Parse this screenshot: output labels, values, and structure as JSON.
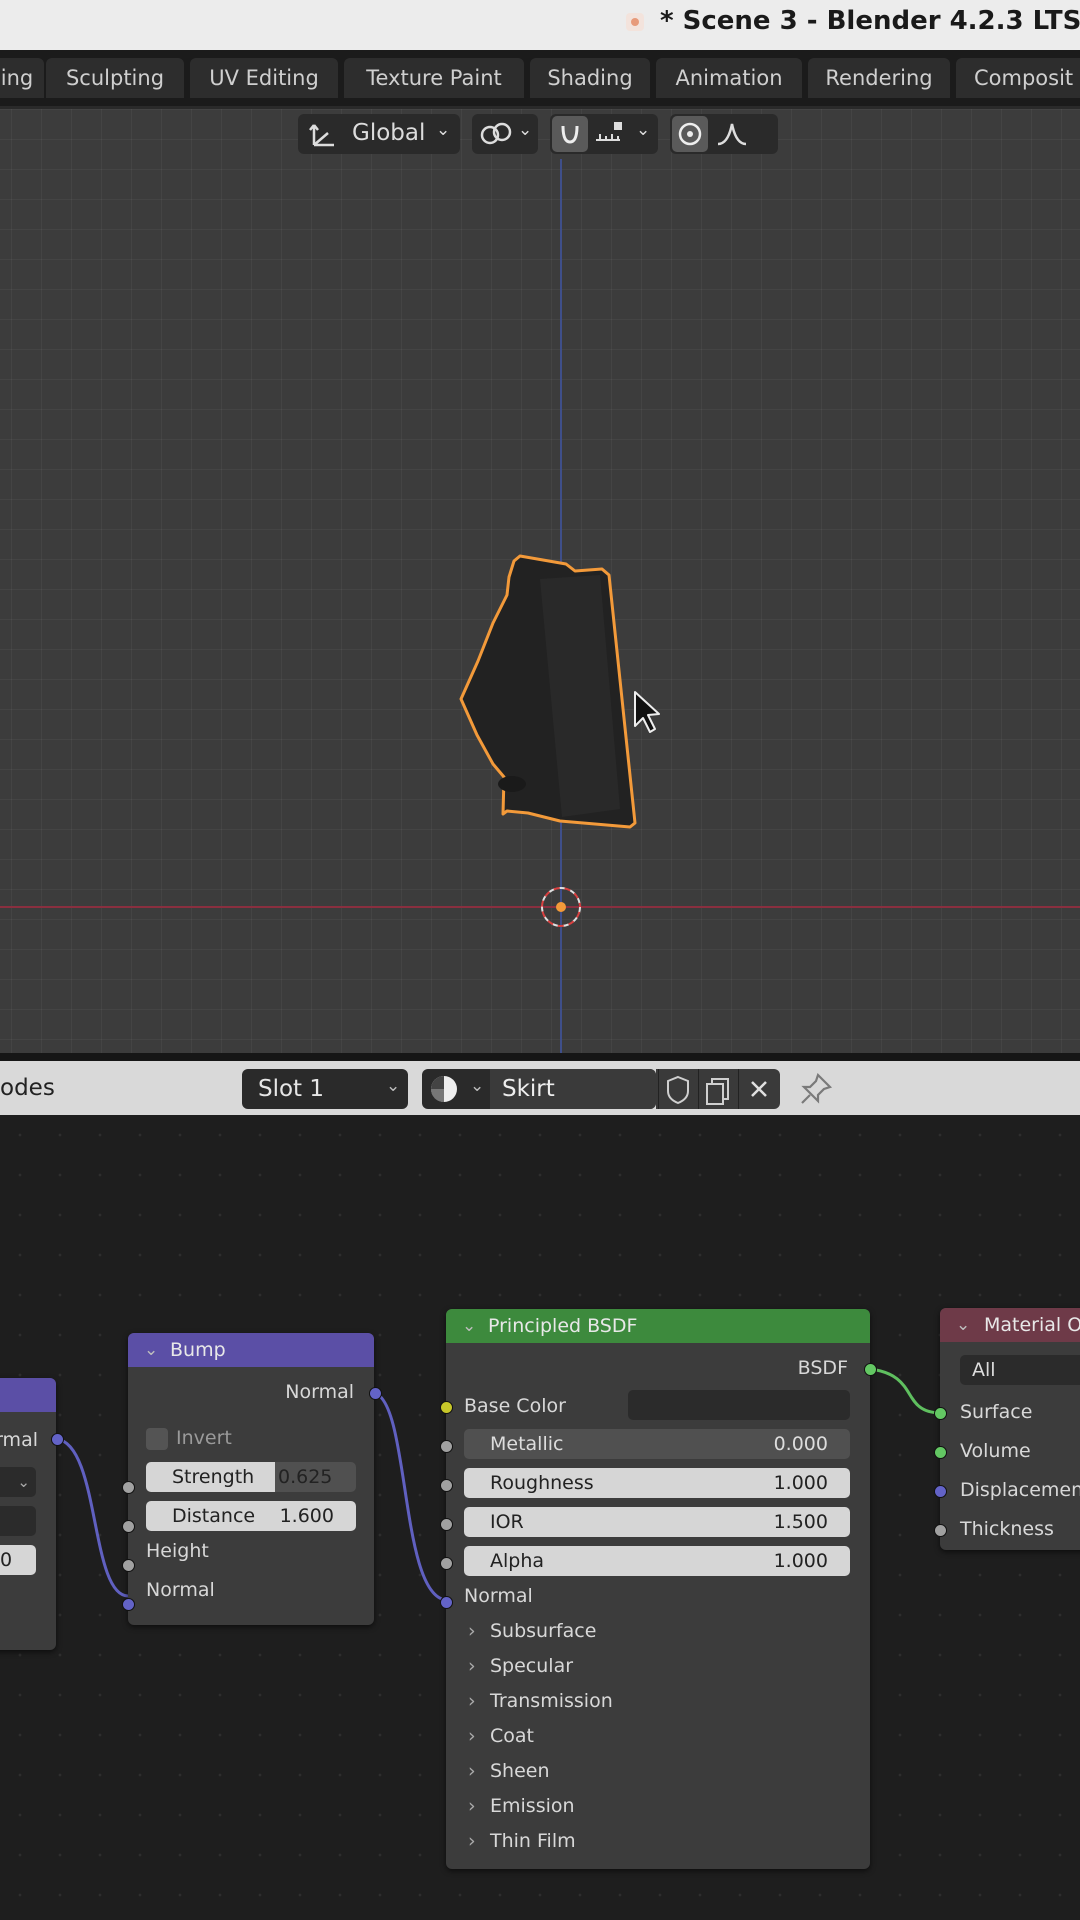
{
  "window": {
    "title": "* Scene 3 - Blender 4.2.3 LTS"
  },
  "workspace_tabs": [
    "ing",
    "Sculpting",
    "UV Editing",
    "Texture Paint",
    "Shading",
    "Animation",
    "Rendering",
    "Composit"
  ],
  "viewport": {
    "orientation": "Global"
  },
  "node_header": {
    "editor_label": "odes",
    "slot": "Slot 1",
    "material_name": "Skirt"
  },
  "nodes": {
    "left_partial": {
      "socket_label": "rmal",
      "value": "0"
    },
    "bump": {
      "title": "Bump",
      "output": "Normal",
      "invert_label": "Invert",
      "strength_label": "Strength",
      "strength_value": "0.625",
      "distance_label": "Distance",
      "distance_value": "1.600",
      "height_label": "Height",
      "normal_input": "Normal"
    },
    "principled": {
      "title": "Principled BSDF",
      "output": "BSDF",
      "base_color": "Base Color",
      "metallic_label": "Metallic",
      "metallic_value": "0.000",
      "roughness_label": "Roughness",
      "roughness_value": "1.000",
      "ior_label": "IOR",
      "ior_value": "1.500",
      "alpha_label": "Alpha",
      "alpha_value": "1.000",
      "normal": "Normal",
      "panels": [
        "Subsurface",
        "Specular",
        "Transmission",
        "Coat",
        "Sheen",
        "Emission",
        "Thin Film"
      ]
    },
    "material_output": {
      "title": "Material Ou",
      "target": "All",
      "inputs": [
        "Surface",
        "Volume",
        "Displacement",
        "Thickness"
      ]
    }
  },
  "colors": {
    "bump_header": "#5b4fa6",
    "principled_header": "#3d8a3d",
    "output_header": "#6e3a48",
    "selection_outline": "#f39a3a"
  }
}
